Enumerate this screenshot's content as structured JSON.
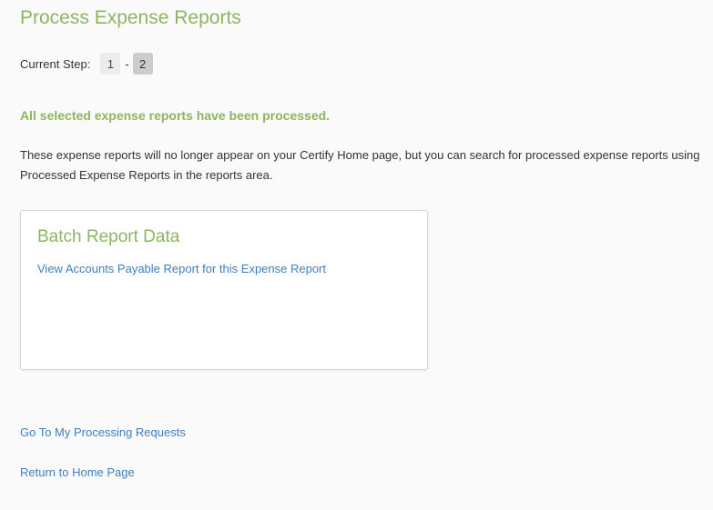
{
  "page": {
    "title": "Process Expense Reports"
  },
  "steps": {
    "label": "Current Step:",
    "items": [
      "1",
      "2"
    ],
    "separator": "-",
    "current": "2"
  },
  "status": {
    "message": "All selected expense reports have been processed.",
    "info": "These expense reports will no longer appear on your Certify Home page, but you can search for processed expense reports using Processed Expense Reports in the reports area."
  },
  "batch_panel": {
    "title": "Batch Report Data",
    "link_label": "View Accounts Payable Report for this Expense Report"
  },
  "navigation": {
    "processing_requests_label": "Go To My Processing Requests",
    "home_label": "Return to Home Page"
  },
  "colors": {
    "accent_green": "#8db561",
    "link_blue": "#3e7fc1"
  }
}
